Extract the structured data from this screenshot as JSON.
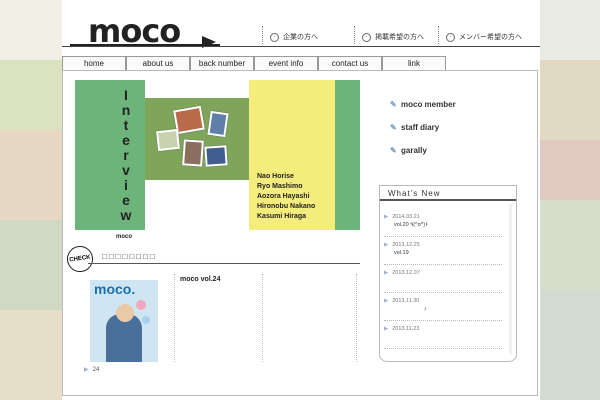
{
  "header": {
    "logo": "moco",
    "links": [
      {
        "icon": "circle-dot-icon",
        "label": "企業の方へ"
      },
      {
        "icon": "circle-dot-icon",
        "label": "掲載希望の方へ"
      },
      {
        "icon": "circle-dot-icon",
        "label": "メンバー希望の方へ"
      }
    ]
  },
  "nav": {
    "tabs": [
      "home",
      "about us",
      "back number",
      "event info",
      "contact us",
      "link"
    ]
  },
  "banner": {
    "title_letters": [
      "I",
      "n",
      "t",
      "e",
      "r",
      "v",
      "i",
      "e",
      "w"
    ],
    "names": [
      "Nao Horise",
      "Ryo Mashimo",
      "Aozora Hayashi",
      "Hironobu Nakano",
      "Kasumi Hiraga"
    ],
    "caption": "moco"
  },
  "check": {
    "badge": "CHECK",
    "title": "□□□□□□□□",
    "issue_title": "moco vol.24",
    "cover_logo": "moco.",
    "issue_num": "24"
  },
  "side": {
    "links": [
      {
        "icon": "pencil-icon",
        "label": "moco member"
      },
      {
        "icon": "pencil-icon",
        "label": "staff diary"
      },
      {
        "icon": "pencil-icon",
        "label": "garally"
      }
    ]
  },
  "whats_new": {
    "heading": "What’s New",
    "items": [
      {
        "date": "2014.03.21",
        "text": "vol.20 ٩(^o^)۶"
      },
      {
        "date": "2013.12.25",
        "text": "vol.19"
      },
      {
        "date": "2013.12.07",
        "text": ""
      },
      {
        "date": "2013.11.30",
        "text": "♪"
      },
      {
        "date": "2013.11.23",
        "text": ""
      }
    ]
  },
  "colors": {
    "green": "#6db47a",
    "yellow": "#f4ec7c",
    "link_blue": "#7aa0c8"
  }
}
